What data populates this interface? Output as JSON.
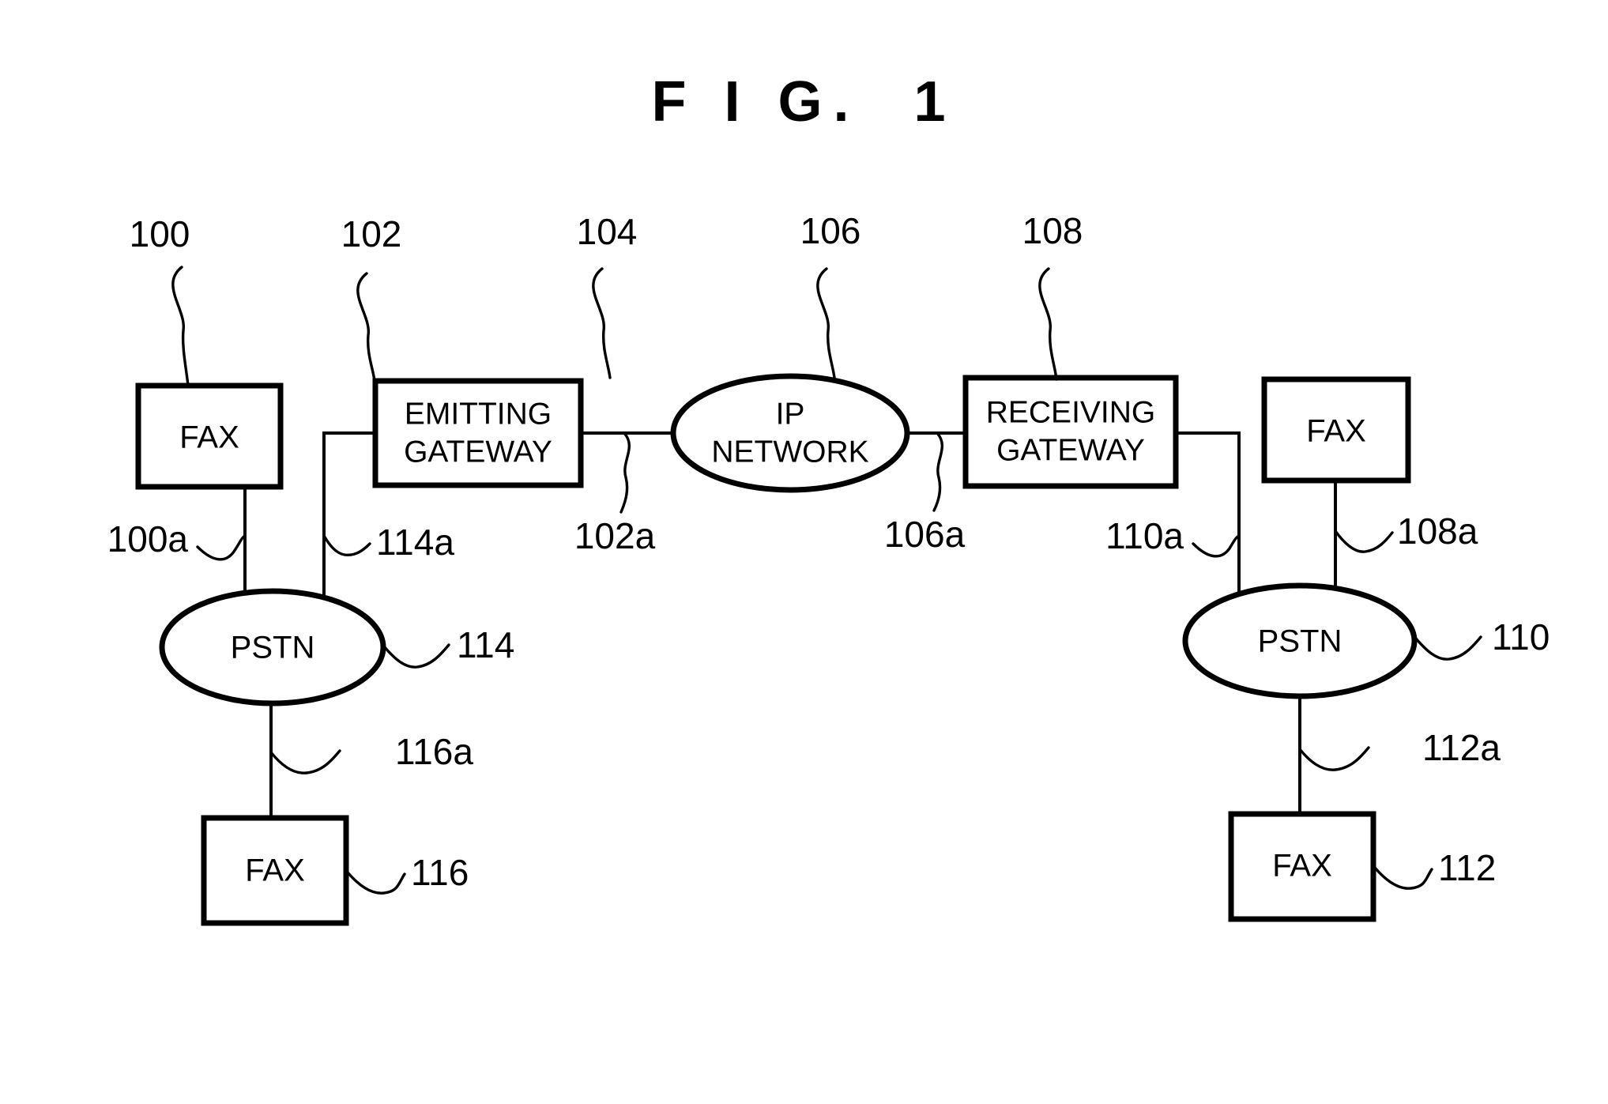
{
  "figure": {
    "title": "F I G.  1",
    "type": "patent-block-diagram",
    "description": "Fax over IP network topology with emitting and receiving gateways"
  },
  "nodes": {
    "fax_100": {
      "label": "FAX",
      "ref": "100"
    },
    "emitting_gateway_102": {
      "label_line1": "EMITTING",
      "label_line2": "GATEWAY",
      "ref": "102"
    },
    "ip_network_104": {
      "label_line1": "IP",
      "label_line2": "NETWORK",
      "ref": "104"
    },
    "receiving_gateway_106": {
      "label_line1": "RECEIVING",
      "label_line2": "GATEWAY",
      "ref": "106"
    },
    "fax_108": {
      "label": "FAX",
      "ref": "108"
    },
    "pstn_114": {
      "label": "PSTN",
      "ref": "114"
    },
    "pstn_110": {
      "label": "PSTN",
      "ref": "110"
    },
    "fax_116": {
      "label": "FAX",
      "ref": "116"
    },
    "fax_112": {
      "label": "FAX",
      "ref": "112"
    }
  },
  "links": {
    "line_100a": "100a",
    "line_114a": "114a",
    "line_102a": "102a",
    "line_106a": "106a",
    "line_110a": "110a",
    "line_108a": "108a",
    "line_116a": "116a",
    "line_112a": "112a"
  },
  "colors": {
    "ink": "#000000",
    "paper": "#ffffff"
  }
}
